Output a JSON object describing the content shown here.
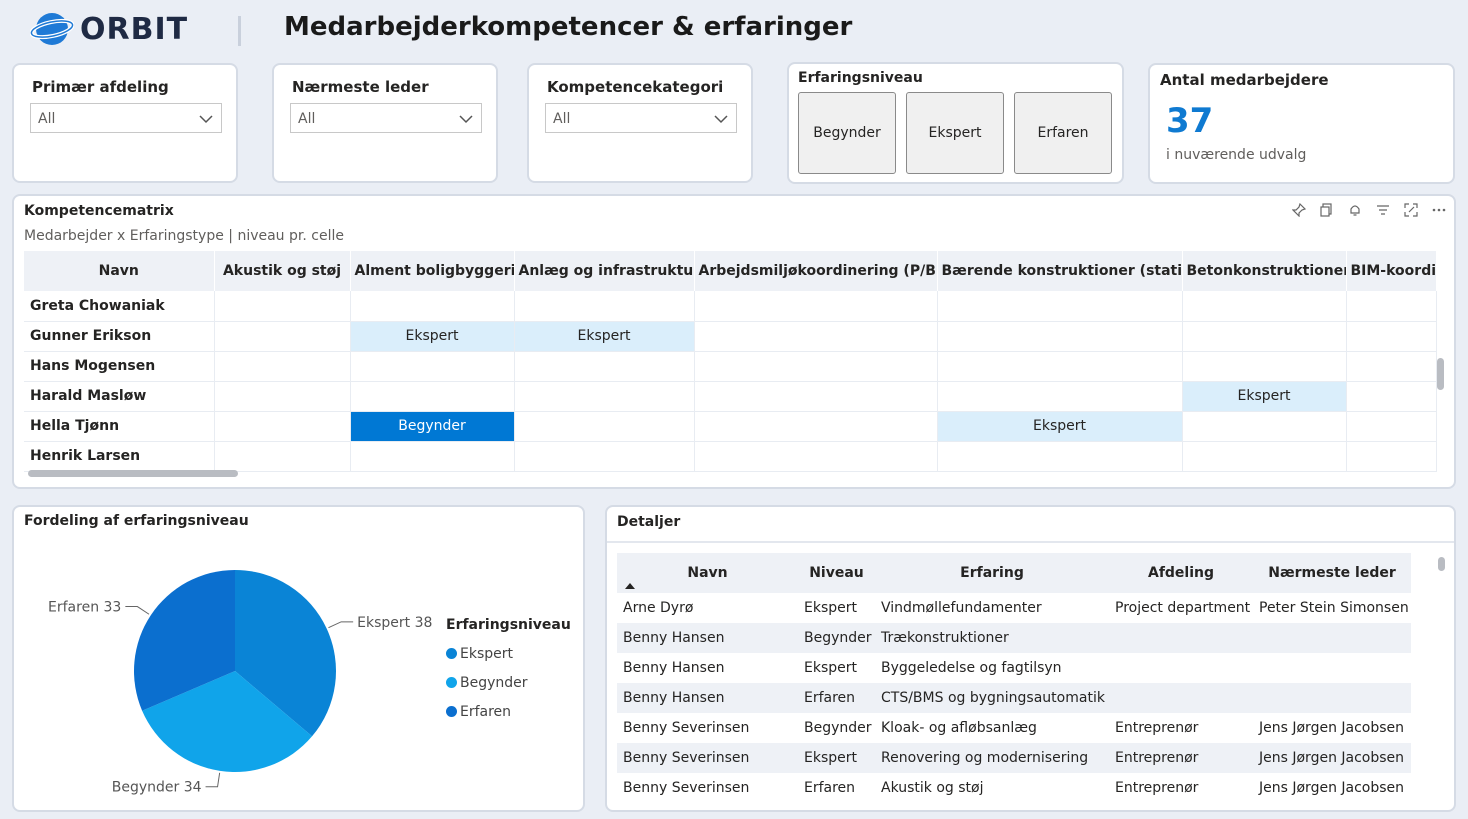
{
  "header": {
    "logo_text": "ORBIT",
    "title": "Medarbejderkompetencer & erfaringer"
  },
  "slicers": [
    {
      "title": "Primær afdeling",
      "value": "All"
    },
    {
      "title": "Nærmeste leder",
      "value": "All"
    },
    {
      "title": "Kompetencekategori",
      "value": "All"
    }
  ],
  "experience_slicer": {
    "title": "Erfaringsniveau",
    "buttons": [
      "Begynder",
      "Ekspert",
      "Erfaren"
    ]
  },
  "kpi": {
    "title": "Antal medarbejdere",
    "value": "37",
    "subtitle": "i nuværende udvalg"
  },
  "matrix": {
    "title": "Kompetencematrix",
    "subtitle": "Medarbejder x Erfaringstype | niveau pr. celle",
    "columns": [
      "Navn",
      "Akustik og støj",
      "Alment boligbyggeri",
      "Anlæg og infrastruktur",
      "Arbejdsmiljøkoordinering (P/B)",
      "Bærende konstruktioner (statik)",
      "Betonkonstruktioner",
      "BIM-koordin"
    ],
    "rows": [
      {
        "name": "Greta Chowaniak",
        "cells": [
          "",
          "",
          "",
          "",
          "",
          "",
          ""
        ]
      },
      {
        "name": "Gunner Erikson",
        "cells": [
          "",
          "Ekspert",
          "Ekspert",
          "",
          "",
          "",
          ""
        ]
      },
      {
        "name": "Hans Mogensen",
        "cells": [
          "",
          "",
          "",
          "",
          "",
          "",
          ""
        ]
      },
      {
        "name": "Harald Masløw",
        "cells": [
          "",
          "",
          "",
          "",
          "",
          "Ekspert",
          ""
        ]
      },
      {
        "name": "Hella Tjønn",
        "cells": [
          "",
          "Begynder",
          "",
          "",
          "Ekspert",
          "",
          ""
        ]
      },
      {
        "name": "Henrik Larsen",
        "cells": [
          "",
          "",
          "",
          "",
          "",
          "",
          ""
        ]
      }
    ]
  },
  "pie": {
    "title": "Fordeling af erfaringsniveau",
    "legend_title": "Erfaringsniveau",
    "colors": {
      "Ekspert": "#0a84d6",
      "Begynder": "#10a4ea",
      "Erfaren": "#0b6fcf"
    }
  },
  "chart_data": {
    "type": "pie",
    "categories": [
      "Ekspert",
      "Begynder",
      "Erfaren"
    ],
    "values": [
      38,
      34,
      33
    ],
    "labels": [
      "Ekspert 38",
      "Begynder 34",
      "Erfaren 33"
    ],
    "legend_title": "Erfaringsniveau",
    "legend_placement": "right"
  },
  "details": {
    "title": "Detaljer",
    "columns": [
      "Navn",
      "Niveau",
      "Erfaring",
      "Afdeling",
      "Nærmeste leder"
    ],
    "rows": [
      [
        "Arne Dyrø",
        "Ekspert",
        "Vindmøllefundamenter",
        "Project department",
        "Peter Stein Simonsen"
      ],
      [
        "Benny Hansen",
        "Begynder",
        "Trækonstruktioner",
        "",
        ""
      ],
      [
        "Benny Hansen",
        "Ekspert",
        "Byggeledelse og fagtilsyn",
        "",
        ""
      ],
      [
        "Benny Hansen",
        "Erfaren",
        "CTS/BMS og bygningsautomatik",
        "",
        ""
      ],
      [
        "Benny Severinsen",
        "Begynder",
        "Kloak- og afløbsanlæg",
        "Entreprenør",
        "Jens Jørgen Jacobsen"
      ],
      [
        "Benny Severinsen",
        "Ekspert",
        "Renovering og modernisering",
        "Entreprenør",
        "Jens Jørgen Jacobsen"
      ],
      [
        "Benny Severinsen",
        "Erfaren",
        "Akustik og støj",
        "Entreprenør",
        "Jens Jørgen Jacobsen"
      ]
    ]
  }
}
